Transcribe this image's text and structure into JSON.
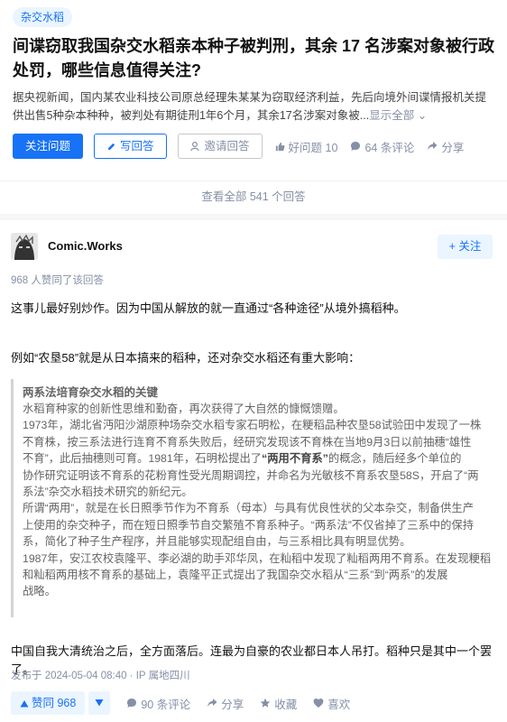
{
  "question": {
    "topic": "杂交水稻",
    "title": "间谍窃取我国杂交水稻亲本种子被判刑，其余 17 名涉案对象被行政处罚，哪些信息值得关注?",
    "excerpt": "据央视新闻，国内某农业科技公司原总经理朱某某为窃取经济利益，先后向境外间谍情报机关提供出售5种杂本种种，被判处有期徒刑1年6个月，其余17名涉案对象被...",
    "show_all": "显示全部",
    "follow_btn": "关注问题",
    "write_btn": "写回答",
    "invite_btn": "邀请回答",
    "good_q": "好问题 10",
    "comments": "64 条评论",
    "share": "分享",
    "view_all": "查看全部 541 个回答"
  },
  "answer": {
    "author": "Comic.Works",
    "follow": "+ 关注",
    "agreed_line": "968 人赞同了该回答",
    "p1": "这事儿最好别炒作。因为中国从解放的就一直通过“各种途径”从境外搞稻种。",
    "p2": "例如“农垦58”就是从日本搞来的稻种，还对杂交水稻还有重大影响：",
    "quote": {
      "heading": "两系法培育杂交水稻的关键",
      "l1": "水稻育种家的创新性思维和勤奋，再次获得了大自然的慷慨馈赠。",
      "l2": "1973年，湖北省沔阳沙湖原种场杂交水稻专家石明松，在粳稻品种农垦58试验田中发现了一株",
      "l3": "不育株，按三系法进行连育不育系失败后，经研究发现该不育株在当地9月3日以前抽穗“雄性",
      "l4a": "不育”，此后抽穗则可育。1981年，石明松提出了",
      "l4b": "“两用不育系”",
      "l4c": "的概念，随后经多个单位的",
      "l5": "协作研究证明该不育系的花粉育性受光周期调控，并命名为光敏核不育系农垦58S，开启了“两",
      "l6": "系法”杂交水稻技术研究的新纪元。",
      "l7": "所谓“两用”，就是在长日照季节作为不育系（母本）与具有优良性状的父本杂交，制备供生产",
      "l8": "上使用的杂交种子，而在短日照季节自交繁殖不育系种子。“两系法”不仅省掉了三系中的保持",
      "l9": "系，简化了种子生产程序，并且能够实现配组自由，与三系相比具有明显优势。",
      "l10": "1987年，安江农校袁隆平、李必湖的助手邓华凤，在籼稻中发现了籼稻两用不育系。在发现粳稻",
      "l11": "和籼稻两用核不育系的基础上，袁隆平正式提出了我国杂交水稻从“三系”到“两系”的发展",
      "l12": "战略。"
    },
    "p3": "中国自我大清统治之后，全方面落后。连最为自豪的农业都日本人吊打。稻种只是其中一个罢了。",
    "published": "发布于 2024-05-04 08:40 · IP 属地四川",
    "vote": "赞同 968",
    "comments": "90 条评论",
    "share": "分享",
    "collect": "收藏",
    "like": "喜欢"
  },
  "colors": {
    "accent": "#1772f6",
    "muted": "#8590a6",
    "accent_bg": "#ebf5ff"
  }
}
